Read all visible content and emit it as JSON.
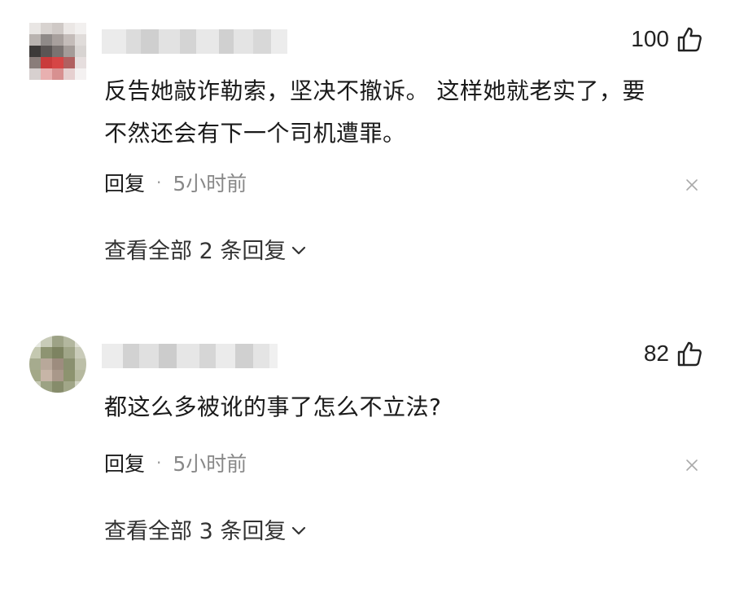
{
  "comments": [
    {
      "like_count": "100",
      "text_line1": "反告她敲诈勒索，坚决不撤诉。 这样她就老实了，要",
      "text_line2": "不然还会有下一个司机遭罪。",
      "reply_label": "回复",
      "separator": "·",
      "time": "5小时前",
      "view_replies": "查看全部 2 条回复"
    },
    {
      "like_count": "82",
      "text_line1": "都这么多被讹的事了怎么不立法?",
      "reply_label": "回复",
      "separator": "·",
      "time": "5小时前",
      "view_replies": "查看全部 3 条回复"
    }
  ],
  "icons": {
    "like": "thumbs-up-icon",
    "close": "close-icon",
    "expand": "chevron-down-icon"
  }
}
